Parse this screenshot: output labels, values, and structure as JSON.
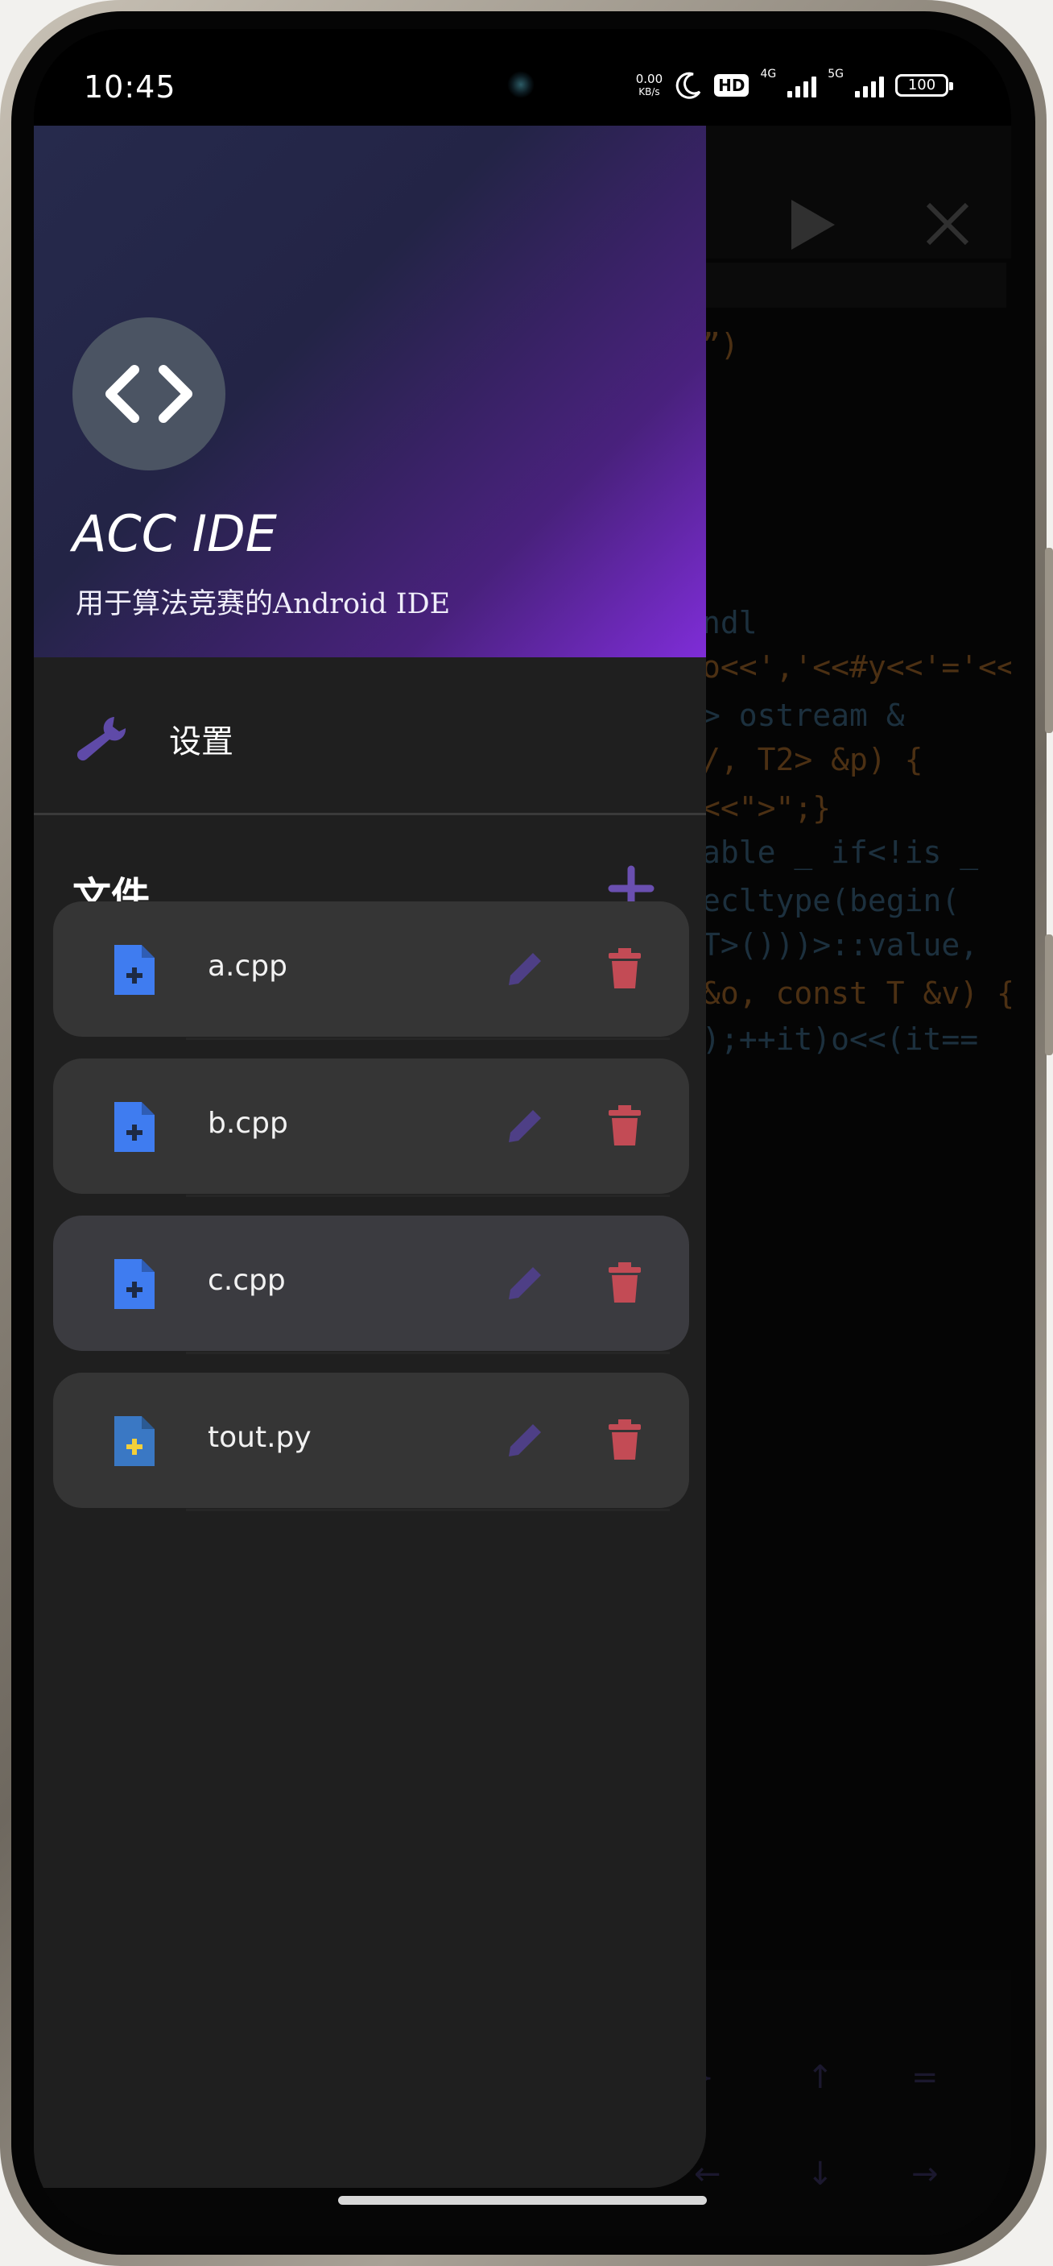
{
  "status_bar": {
    "time": "10:45",
    "net_speed_value": "0.00",
    "net_speed_unit": "KB/s",
    "hd_badge": "HD",
    "network_4g": "4G",
    "network_5g": "5G",
    "battery": "100"
  },
  "drawer": {
    "app_title": "ACC IDE",
    "app_subtitle": "用于算法竞赛的Android IDE",
    "settings_label": "设置",
    "files_title": "文件",
    "files": [
      {
        "name": "a.cpp",
        "type": "cpp"
      },
      {
        "name": "b.cpp",
        "type": "cpp"
      },
      {
        "name": "c.cpp",
        "type": "cpp"
      },
      {
        "name": "tout.py",
        "type": "py"
      }
    ]
  },
  "editor": {
    "code_lines": [
      "”)",
      "ndl",
      "o<<','<<#y<<'='<<(y",
      "> ostream &",
      "/, T2> &p) {",
      "<<\">\";}",
      "able _ if<!is _",
      "ecltype(begin(",
      "T>()))>::value,",
      "&o, const T &v) {",
      ");++it)o<<(it=="
    ],
    "keypad_keys": [
      "}",
      "↑",
      "=",
      "←",
      "↓",
      "→"
    ]
  },
  "colors": {
    "accent": "#6a4fb0",
    "delete": "#c34b55",
    "cpp_icon": "#3f7cf0",
    "py_icon": "#3a78c4"
  }
}
